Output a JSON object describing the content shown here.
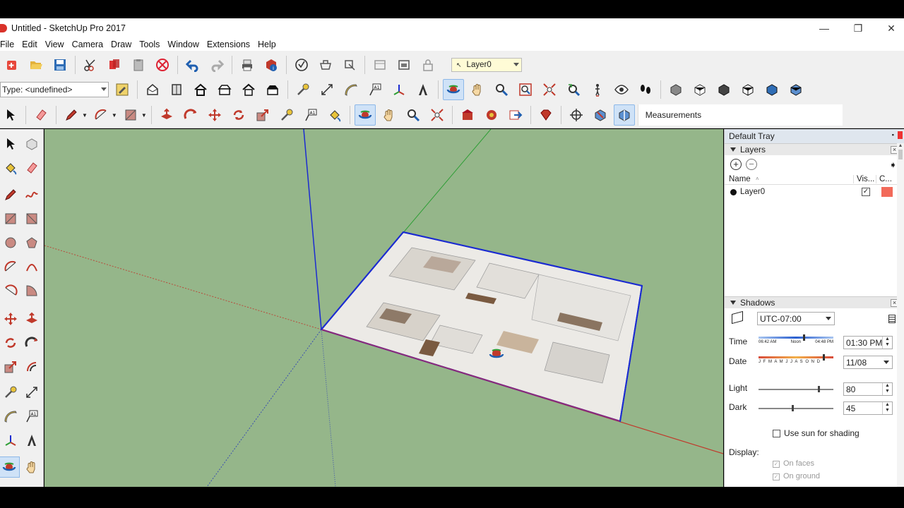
{
  "window": {
    "title": "Untitled - SketchUp Pro 2017",
    "minimize": "—",
    "restore": "❐",
    "close": "✕"
  },
  "menu": [
    "File",
    "Edit",
    "View",
    "Camera",
    "Draw",
    "Tools",
    "Window",
    "Extensions",
    "Help"
  ],
  "toolbar": {
    "type_label": "Type: <undefined>",
    "layer_value": "Layer0",
    "measurements_label": "Measurements"
  },
  "tray": {
    "title": "Default Tray",
    "layers": {
      "title": "Layers",
      "columns": [
        "Name",
        "Vis...",
        "C..."
      ],
      "rows": [
        {
          "name": "Layer0",
          "visible": true,
          "color": "#f26a5a"
        }
      ]
    },
    "shadows": {
      "title": "Shadows",
      "timezone": "UTC-07:00",
      "time_label": "Time",
      "time_value": "01:30 PM",
      "time_scale": {
        "start": "06:42 AM",
        "mid": "Noon",
        "end": "04:48 PM"
      },
      "time_fraction": 0.6,
      "date_label": "Date",
      "date_value": "11/08",
      "months": "J F M A M J J A S O N D",
      "date_fraction": 0.86,
      "light_label": "Light",
      "light_value": "80",
      "light_fraction": 0.8,
      "dark_label": "Dark",
      "dark_value": "45",
      "dark_fraction": 0.45,
      "use_sun_label": "Use sun for shading",
      "use_sun": false,
      "display_label": "Display:",
      "on_faces": "On faces",
      "on_ground": "On ground"
    }
  },
  "colors": {
    "viewport": "#95b68a",
    "axis_red": "#c0392b",
    "axis_green": "#2e9e35",
    "axis_blue": "#1b2bd1",
    "selection": "#1b2bd1"
  }
}
